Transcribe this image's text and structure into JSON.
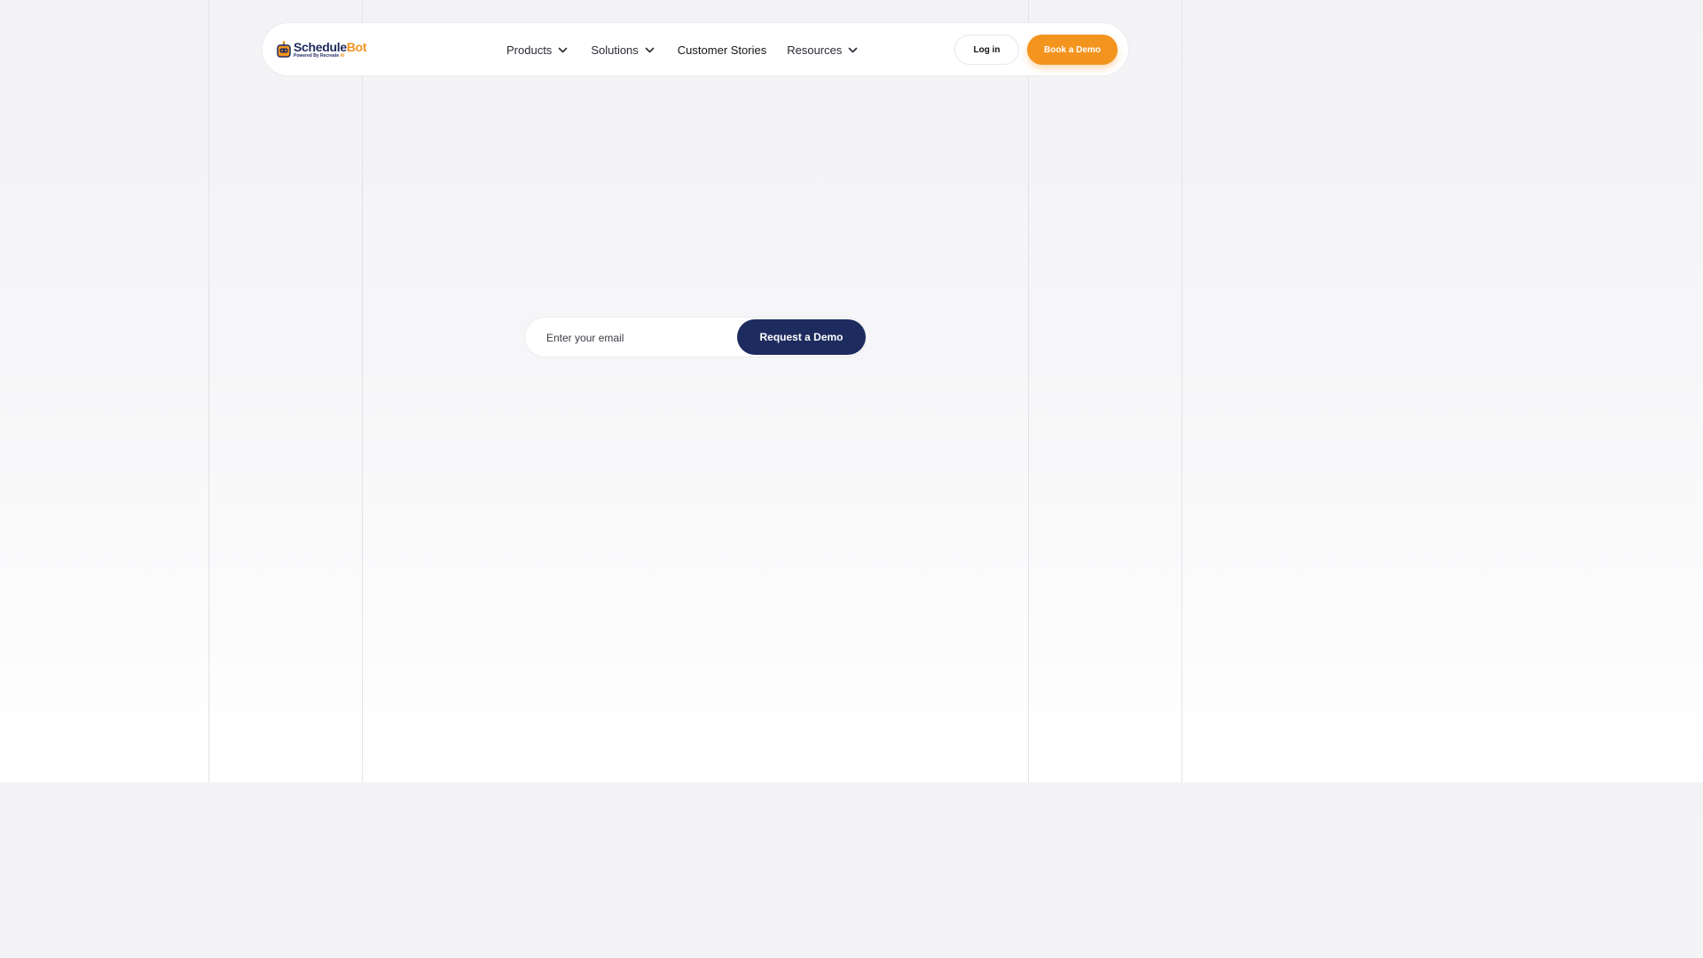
{
  "brand": {
    "name_part1": "Schedule",
    "name_part2": "Bot",
    "tagline_part1": "Powered By Recreate",
    "tagline_part2": "AI",
    "colors": {
      "navy": "#1d2b5e",
      "orange": "#f3941f"
    },
    "icon": "robot-logo-icon"
  },
  "nav": {
    "items": [
      {
        "label": "Products",
        "has_dropdown": true,
        "icon": "chevron-down-icon"
      },
      {
        "label": "Solutions",
        "has_dropdown": true,
        "icon": "chevron-down-icon"
      },
      {
        "label": "Customer Stories",
        "has_dropdown": false
      },
      {
        "label": "Resources",
        "has_dropdown": true,
        "icon": "chevron-down-icon"
      }
    ],
    "login_label": "Log in",
    "book_demo_label": "Book a Demo"
  },
  "hero": {
    "email_placeholder": "Enter your email",
    "email_value": "",
    "submit_label": "Request a Demo"
  }
}
